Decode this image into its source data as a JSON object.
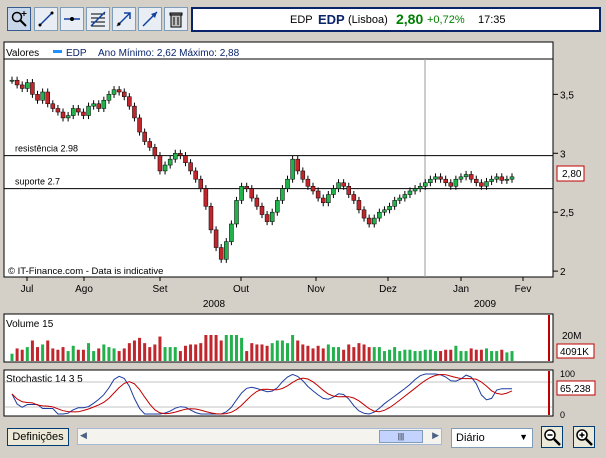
{
  "toolbar": {
    "icons": [
      "crosshair-zoom-icon",
      "line-draw-icon",
      "horizontal-line-icon",
      "fibonacci-icon",
      "trend-arrow-icon",
      "arrow-line-icon",
      "trash-icon"
    ]
  },
  "quote": {
    "code": "EDP",
    "symbol": "EDP",
    "exchange": "(Lisboa)",
    "price": "2,80",
    "change": "+0,72%",
    "time": "17:35",
    "up_color": "#008000"
  },
  "price_panel": {
    "legend_label": "Valores",
    "series_name": "EDP",
    "minmax_text": "Ano Mínimo: 2,62 Máximo: 2,88",
    "watermark": "© IT-Finance.com - Data is indicative",
    "last_value_label": "2,80"
  },
  "volume_panel": {
    "label": "Volume 15",
    "value_label": "4091K",
    "axis_label": "20M"
  },
  "stoch_panel": {
    "label": "Stochastic 14 3 5",
    "value_label": "65,238"
  },
  "bottom": {
    "definitions_label": "Definições",
    "period_label": "Diário"
  },
  "chart_data": {
    "type": "candlestick",
    "price": {
      "y_ticks": [
        "3,5",
        "3",
        "2,5",
        "2"
      ],
      "ylim": [
        1.95,
        3.8
      ],
      "hlines": [
        {
          "label": "resistência 2.98",
          "value": 2.98
        },
        {
          "label": "suporte 2.7",
          "value": 2.7
        }
      ],
      "last_value": 2.8,
      "series": [
        {
          "name": "EDP",
          "close": [
            3.62,
            3.58,
            3.55,
            3.6,
            3.5,
            3.45,
            3.52,
            3.42,
            3.38,
            3.35,
            3.3,
            3.32,
            3.38,
            3.35,
            3.32,
            3.4,
            3.42,
            3.38,
            3.45,
            3.5,
            3.54,
            3.52,
            3.48,
            3.4,
            3.3,
            3.18,
            3.1,
            3.05,
            2.98,
            2.85,
            2.9,
            2.95,
            3.0,
            2.98,
            2.92,
            2.85,
            2.78,
            2.7,
            2.55,
            2.35,
            2.2,
            2.1,
            2.25,
            2.4,
            2.6,
            2.72,
            2.7,
            2.62,
            2.55,
            2.48,
            2.42,
            2.5,
            2.6,
            2.7,
            2.78,
            2.95,
            2.85,
            2.78,
            2.72,
            2.68,
            2.62,
            2.58,
            2.65,
            2.7,
            2.75,
            2.72,
            2.65,
            2.6,
            2.52,
            2.45,
            2.4,
            2.45,
            2.5,
            2.52,
            2.55,
            2.6,
            2.62,
            2.65,
            2.68,
            2.7,
            2.72,
            2.75,
            2.78,
            2.8,
            2.78,
            2.75,
            2.72,
            2.78,
            2.8,
            2.82,
            2.78,
            2.75,
            2.72,
            2.76,
            2.78,
            2.8,
            2.77,
            2.78,
            2.8
          ]
        }
      ]
    },
    "volume": {
      "y_ticks": [
        "20M"
      ]
    },
    "stochastic": {
      "y_ticks": [
        "100",
        "0"
      ],
      "hlines": [
        80,
        20
      ]
    },
    "x_axis": {
      "months": [
        "Jul",
        "Ago",
        "Set",
        "Out",
        "Nov",
        "Dez",
        "Jan",
        "Fev"
      ],
      "years": [
        "2008",
        "2009"
      ]
    }
  }
}
